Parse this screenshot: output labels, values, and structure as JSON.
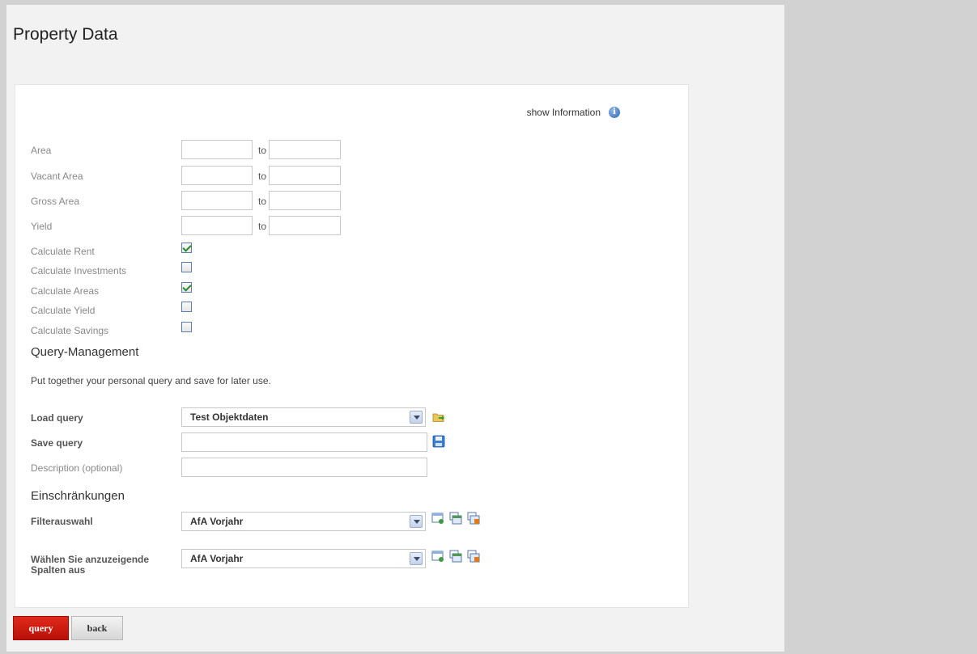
{
  "page": {
    "title": "Property Data"
  },
  "info": {
    "label": "show Information",
    "icon": "info-icon"
  },
  "ranges": [
    {
      "label": "Area",
      "from": "",
      "to_label": "to",
      "to": ""
    },
    {
      "label": "Vacant Area",
      "from": "",
      "to_label": "to",
      "to": ""
    },
    {
      "label": "Gross Area",
      "from": "",
      "to_label": "to",
      "to": ""
    },
    {
      "label": "Yield",
      "from": "",
      "to_label": "to",
      "to": ""
    }
  ],
  "checks": [
    {
      "label": "Calculate Rent",
      "checked": true
    },
    {
      "label": "Calculate Investments",
      "checked": false
    },
    {
      "label": "Calculate Areas",
      "checked": true
    },
    {
      "label": "Calculate Yield",
      "checked": false
    },
    {
      "label": "Calculate Savings",
      "checked": false
    }
  ],
  "query_mgmt": {
    "heading": "Query-Management",
    "description": "Put together your personal query and save for later use.",
    "load_label": "Load query",
    "load_value": "Test Objektdaten",
    "save_label": "Save query",
    "save_value": "",
    "desc_label": "Description (optional)",
    "desc_value": ""
  },
  "restrictions": {
    "heading": "Einschränkungen",
    "filter_label": "Filterauswahl",
    "filter_value": "AfA Vorjahr",
    "columns_label": "Wählen Sie anzuzeigende Spalten aus",
    "columns_value": "AfA Vorjahr"
  },
  "buttons": {
    "query": "query",
    "back": "back"
  },
  "colors": {
    "primary_button": "#c8150c",
    "accent_check": "#2a8a2a",
    "info_blue": "#2f67b5"
  }
}
